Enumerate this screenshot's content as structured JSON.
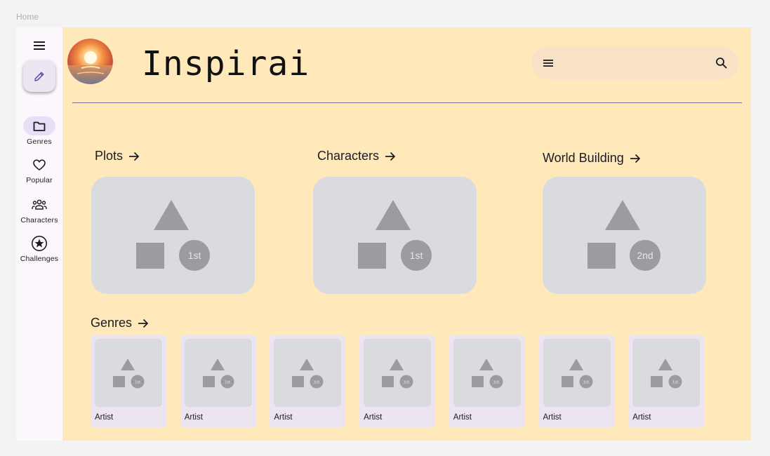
{
  "breadcrumb": "Home",
  "rail": {
    "items": [
      {
        "label": "Genres",
        "icon": "folder-icon",
        "active": true
      },
      {
        "label": "Popular",
        "icon": "heart-icon",
        "active": false
      },
      {
        "label": "Characters",
        "icon": "group-icon",
        "active": false
      },
      {
        "label": "Challenges",
        "icon": "star-circle-icon",
        "active": false
      }
    ]
  },
  "header": {
    "title": "Inspirai"
  },
  "sections": [
    {
      "title": "Plots",
      "badge": "1st"
    },
    {
      "title": "Characters",
      "badge": "1st"
    },
    {
      "title": "World Building",
      "badge": "2nd"
    }
  ],
  "genres": {
    "title": "Genres",
    "cards": [
      {
        "label": "Artist",
        "badge": "1st"
      },
      {
        "label": "Artist",
        "badge": "1st"
      },
      {
        "label": "Artist",
        "badge": "1st"
      },
      {
        "label": "Artist",
        "badge": "1st"
      },
      {
        "label": "Artist",
        "badge": "1st"
      },
      {
        "label": "Artist",
        "badge": "1st"
      },
      {
        "label": "Artist",
        "badge": "1st"
      }
    ]
  },
  "colors": {
    "main_bg": "#ffe8b9",
    "rail_bg": "#fbf7fd",
    "accent": "#6750a4",
    "placeholder": "#dadbdf",
    "shape": "#9a9ca1"
  }
}
